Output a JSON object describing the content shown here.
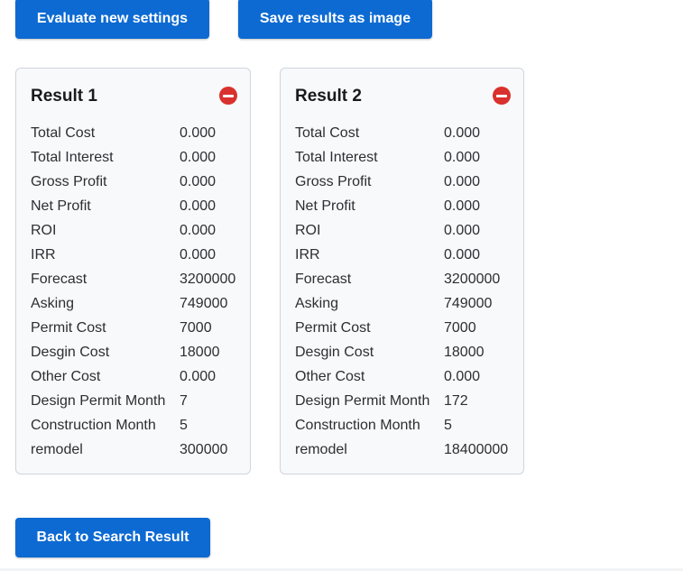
{
  "buttons": {
    "evaluate": "Evaluate new settings",
    "save": "Save results as image",
    "back": "Back to Search Result"
  },
  "colors": {
    "primary": "#0d6ad2",
    "remove": "#d9312d",
    "card_bg": "#f8f9fb",
    "card_border": "#cfd5dc"
  },
  "results": [
    {
      "title": "Result 1",
      "remove_icon": "minus-circle-icon",
      "rows": [
        {
          "label": "Total Cost",
          "value": "0.000"
        },
        {
          "label": "Total Interest",
          "value": "0.000"
        },
        {
          "label": "Gross Profit",
          "value": "0.000"
        },
        {
          "label": "Net Profit",
          "value": "0.000"
        },
        {
          "label": "ROI",
          "value": "0.000"
        },
        {
          "label": "IRR",
          "value": "0.000"
        },
        {
          "label": "Forecast",
          "value": "3200000"
        },
        {
          "label": "Asking",
          "value": "749000"
        },
        {
          "label": "Permit Cost",
          "value": "7000"
        },
        {
          "label": "Desgin Cost",
          "value": "18000"
        },
        {
          "label": "Other Cost",
          "value": "0.000"
        },
        {
          "label": "Design Permit Month",
          "value": "7"
        },
        {
          "label": "Construction Month",
          "value": "5"
        },
        {
          "label": "remodel",
          "value": "300000"
        }
      ]
    },
    {
      "title": "Result 2",
      "remove_icon": "minus-circle-icon",
      "rows": [
        {
          "label": "Total Cost",
          "value": "0.000"
        },
        {
          "label": "Total Interest",
          "value": "0.000"
        },
        {
          "label": "Gross Profit",
          "value": "0.000"
        },
        {
          "label": "Net Profit",
          "value": "0.000"
        },
        {
          "label": "ROI",
          "value": "0.000"
        },
        {
          "label": "IRR",
          "value": "0.000"
        },
        {
          "label": "Forecast",
          "value": "3200000"
        },
        {
          "label": "Asking",
          "value": "749000"
        },
        {
          "label": "Permit Cost",
          "value": "7000"
        },
        {
          "label": "Desgin Cost",
          "value": "18000"
        },
        {
          "label": "Other Cost",
          "value": "0.000"
        },
        {
          "label": "Design Permit Month",
          "value": "172"
        },
        {
          "label": "Construction Month",
          "value": "5"
        },
        {
          "label": "remodel",
          "value": "18400000"
        }
      ]
    }
  ]
}
